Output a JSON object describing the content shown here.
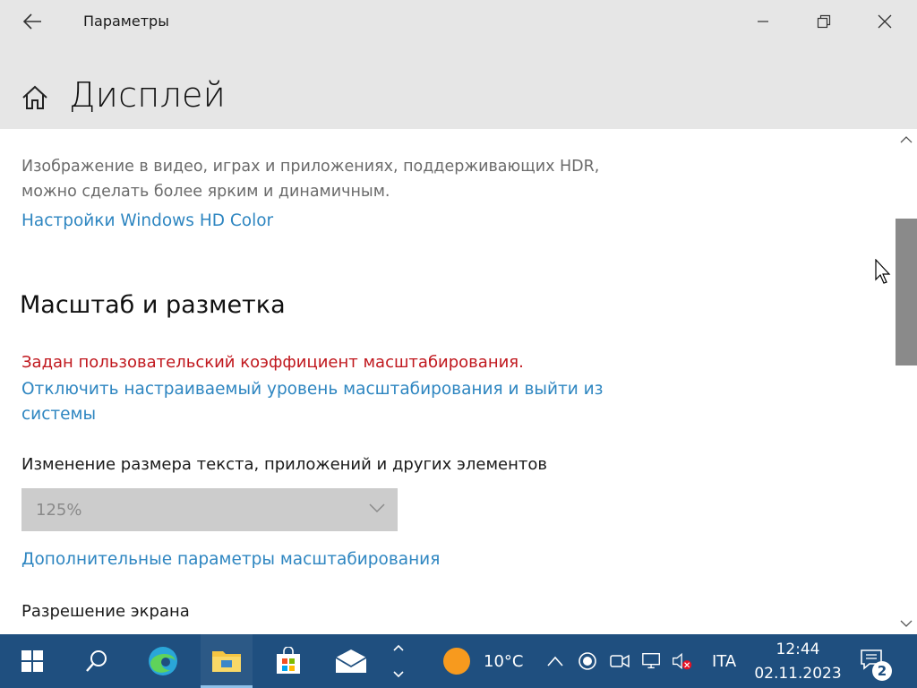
{
  "window": {
    "title": "Параметры"
  },
  "header": {
    "page_title": "Дисплей"
  },
  "content": {
    "hdr_description": "Изображение в видео, играх и приложениях, поддерживающих HDR, можно сделать более ярким и динамичным.",
    "hd_color_link": "Настройки Windows HD Color",
    "scale_section_title": "Масштаб и разметка",
    "custom_scale_warning": "Задан пользовательский коэффициент масштабирования.",
    "disable_custom_scale_link": "Отключить настраиваемый уровень масштабирования и выйти из системы",
    "text_size_label": "Изменение размера текста, приложений и других элементов",
    "scale_dropdown_value": "125%",
    "advanced_scaling_link": "Дополнительные параметры масштабирования",
    "resolution_label": "Разрешение экрана"
  },
  "taskbar": {
    "weather_temp": "10°C",
    "language": "ITA",
    "time": "12:44",
    "date": "02.11.2023",
    "notification_count": "2",
    "accent_color": "#1f4f7f"
  },
  "colors": {
    "link": "#2e86c1",
    "warning": "#c0171d",
    "header_bg": "#e6e6e6"
  }
}
